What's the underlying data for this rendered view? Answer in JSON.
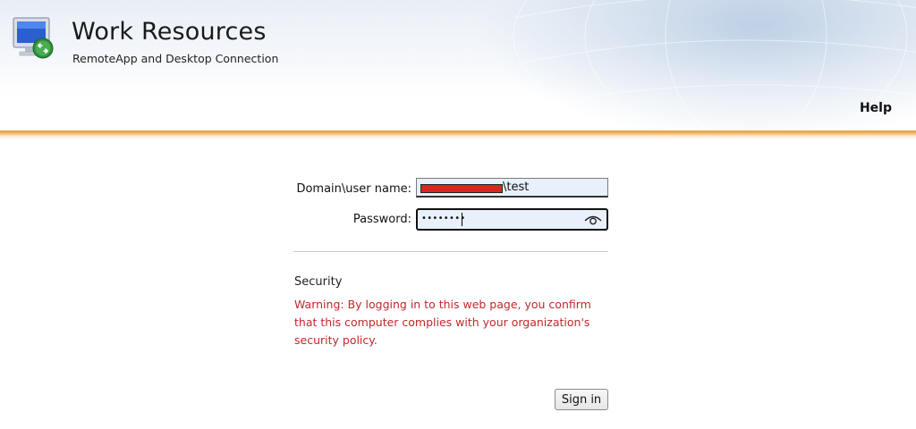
{
  "header": {
    "title": "Work Resources",
    "subtitle": "RemoteApp and Desktop Connection",
    "help_label": "Help",
    "app_icon": "remote-desktop-icon",
    "accent_color": "#e39a3c"
  },
  "form": {
    "username_label": "Domain\\user name:",
    "username_suffix": "\\test",
    "username_redaction_color": "#d42a1e",
    "password_label": "Password:",
    "password_mask": "••••••••",
    "show_password_icon": "eye-icon"
  },
  "security": {
    "heading": "Security",
    "warning": "Warning: By logging in to this web page, you confirm that this computer complies with your organization's security policy.",
    "warning_color": "#c0282b"
  },
  "actions": {
    "signin_label": "Sign in"
  }
}
